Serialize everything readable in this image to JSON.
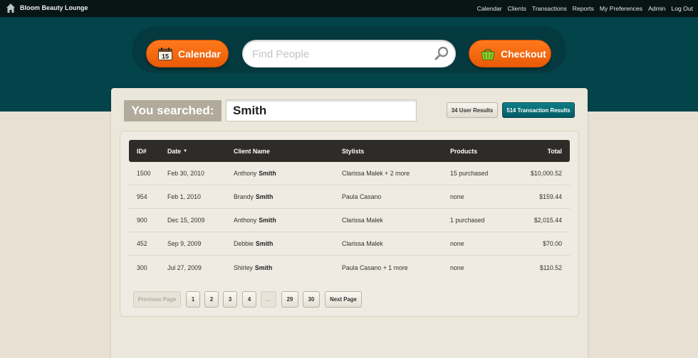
{
  "app": {
    "brand": "Bloom Beauty Lounge"
  },
  "nav": [
    "Calendar",
    "Clients",
    "Transactions",
    "Reports",
    "My Preferences",
    "Admin",
    "Log Out"
  ],
  "toolbar": {
    "calendar_label": "Calendar",
    "calendar_day": "15",
    "search_placeholder": "Find People",
    "checkout_label": "Checkout"
  },
  "search": {
    "you_searched_label": "You searched:",
    "query": "Smith",
    "user_results_label": "34 User Results",
    "transaction_results_label": "514 Transaction Results"
  },
  "table": {
    "headers": {
      "id": "ID#",
      "date": "Date",
      "date_sort": "▼",
      "client": "Client Name",
      "stylists": "Stylists",
      "products": "Products",
      "total": "Total"
    },
    "rows": [
      {
        "id": "1500",
        "date": "Feb 30, 2010",
        "first": "Anthony",
        "last": "Smith",
        "stylists": "Clarissa Malek + 2 more",
        "products": "15 purchased",
        "total": "$10,000.52"
      },
      {
        "id": "954",
        "date": "Feb 1, 2010",
        "first": "Brandy",
        "last": "Smith",
        "stylists": "Paula Casano",
        "products": "none",
        "total": "$159.44"
      },
      {
        "id": "900",
        "date": "Dec 15, 2009",
        "first": "Anthony",
        "last": "Smith",
        "stylists": "Clarissa Malek",
        "products": "1 purchased",
        "total": "$2,015.44"
      },
      {
        "id": "452",
        "date": "Sep 9, 2009",
        "first": "Debbie",
        "last": "Smith",
        "stylists": "Clarissa Malek",
        "products": "none",
        "total": "$70.00"
      },
      {
        "id": "300",
        "date": "Jul 27, 2009",
        "first": "Shirley",
        "last": "Smith",
        "stylists": "Paula Casano + 1 more",
        "products": "none",
        "total": "$110.52"
      }
    ]
  },
  "pagination": {
    "previous": "Previous Page",
    "pages": [
      "1",
      "2",
      "3",
      "4",
      "...",
      "29",
      "30"
    ],
    "next": "Next Page"
  },
  "colors": {
    "teal": "#03434a",
    "orange": "#f26c0d",
    "topbar": "#071514",
    "background": "#e8e1d3"
  },
  "icons": {
    "home": "home-icon",
    "calendar": "calendar-icon",
    "search": "search-icon",
    "checkout": "basket-icon"
  }
}
